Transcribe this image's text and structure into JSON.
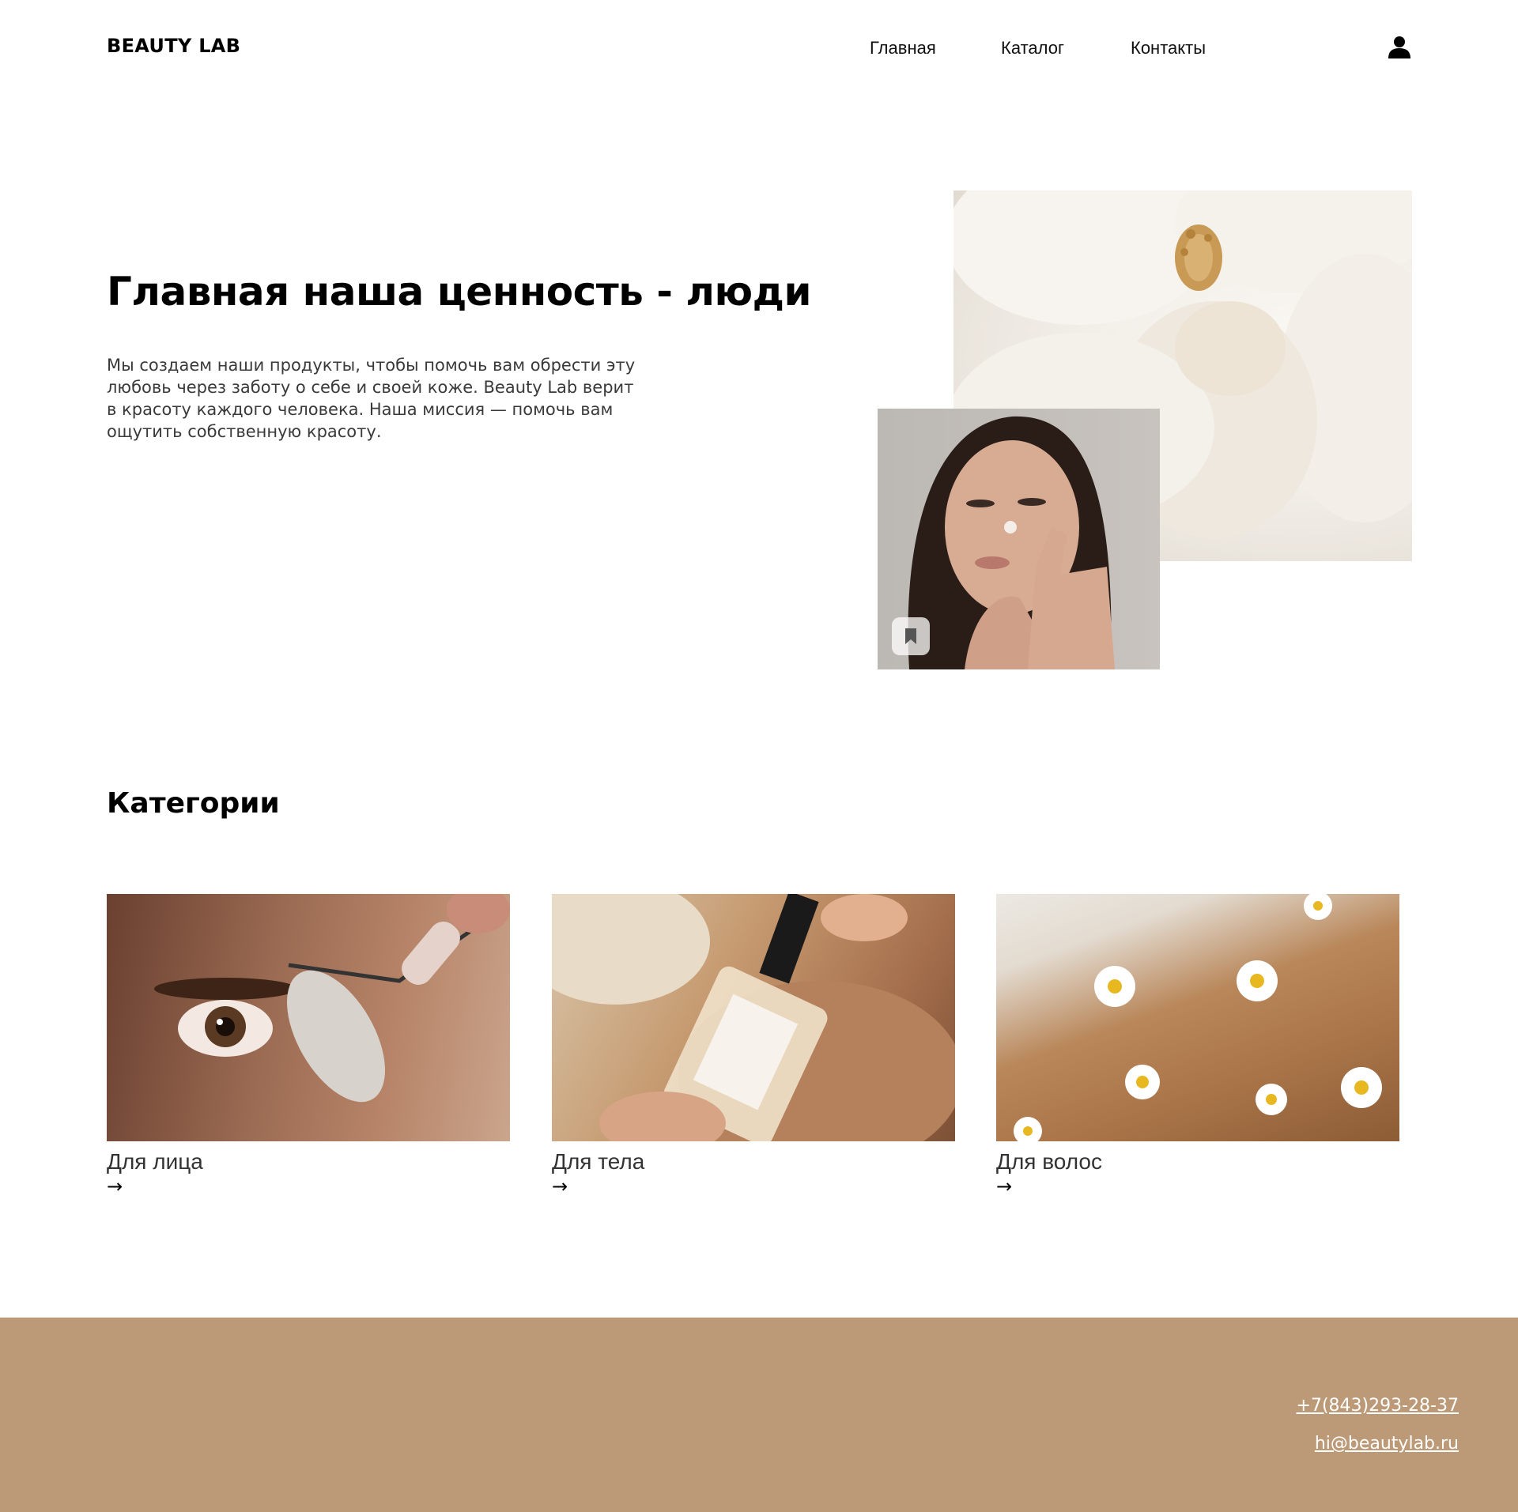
{
  "header": {
    "logo": "BEAUTY LAB",
    "nav": [
      "Главная",
      "Каталог",
      "Контакты"
    ],
    "user_icon": "user-icon"
  },
  "hero": {
    "title": "Главная наша ценность - люди",
    "text": "Мы создаем наши продукты, чтобы помочь вам обрести эту любовь через заботу о себе и своей коже. Beauty Lab верит в красоту каждого человека. Наша миссия — помочь вам ощутить собственную красоту.",
    "images": [
      "flower-photo",
      "woman-photo"
    ],
    "bookmark_icon": "bookmark-icon"
  },
  "categories": {
    "heading": "Категории",
    "items": [
      {
        "title": "Для лица",
        "arrow": "→",
        "image": "face-roller-photo"
      },
      {
        "title": "Для тела",
        "arrow": "→",
        "image": "body-oil-photo"
      },
      {
        "title": "Для волос",
        "arrow": "→",
        "image": "hair-daisies-photo"
      }
    ]
  },
  "footer": {
    "phone": "+7(843)293-28-37",
    "email": "hi@beautylab.ru"
  },
  "colors": {
    "footer_bg": "#bd9a77",
    "text": "#000000",
    "body_text": "#3a3a3a",
    "footer_text": "#ffffff"
  }
}
